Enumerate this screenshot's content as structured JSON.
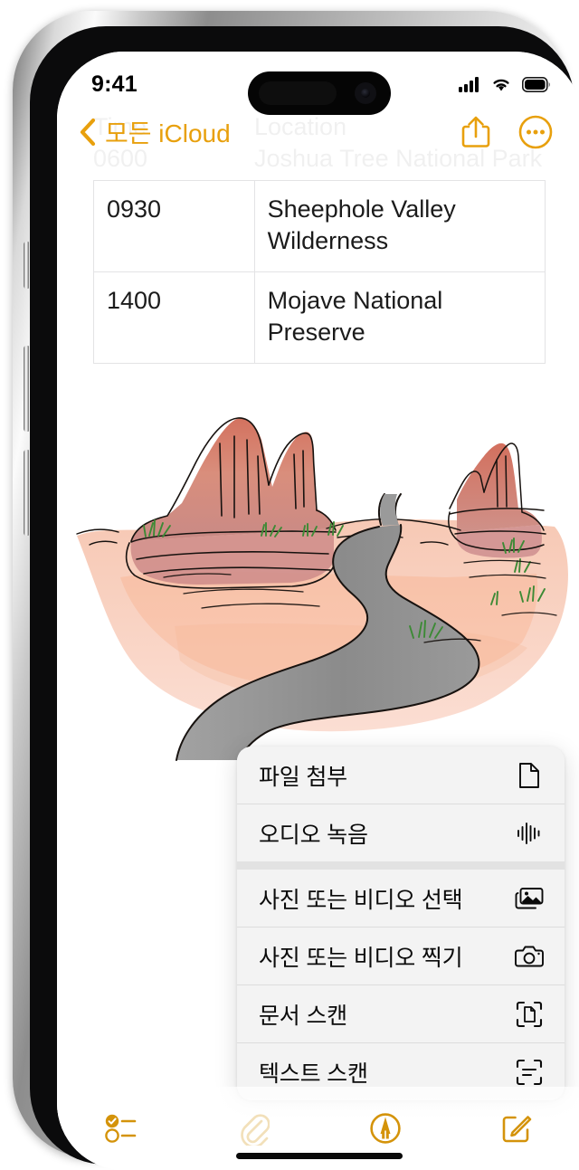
{
  "device": {
    "name": "iphone-15-pro",
    "frame_color": "#b8b8b8",
    "bezel_color": "#0b0b0c"
  },
  "status_bar": {
    "time": "9:41",
    "cellular_icon": "cellular-bars-icon",
    "wifi_icon": "wifi-icon",
    "battery_icon": "battery-full-icon",
    "battery_level": 100
  },
  "nav_bar": {
    "back_label": "모든 iCloud",
    "back_chevron_icon": "chevron-left-icon",
    "share_icon": "share-icon",
    "more_icon": "ellipsis-circle-icon",
    "accent_color": "#e8a00d"
  },
  "note": {
    "ghost_header": {
      "col1": "Time",
      "col2": "Location"
    },
    "ghost_row": {
      "col1": "0600",
      "col2": "Joshua Tree National Park"
    },
    "table": {
      "columns": [
        "Time",
        "Location"
      ],
      "rows": [
        {
          "time": "0930",
          "location": "Sheephole Valley Wilderness"
        },
        {
          "time": "1400",
          "location": "Mojave National Preserve"
        }
      ]
    },
    "illustration": {
      "name": "desert-landscape-sketch",
      "description": "Hand drawn watercolor sketch of desert mesas and a winding road",
      "colors": {
        "mesa_rock": "#d08878",
        "mesa_highlight": "#e8a58c",
        "sand": "#f7cdbb",
        "sand_light": "#fbe0d5",
        "road": "#8e8e8e",
        "grass": "#3f8f3a",
        "outline": "#17120f"
      }
    }
  },
  "attach_menu": {
    "background_color": "#f3f3f3",
    "groups": [
      {
        "items": [
          {
            "label": "파일 첨부",
            "icon": "document-icon"
          },
          {
            "label": "오디오 녹음",
            "icon": "audio-waveform-icon"
          }
        ]
      },
      {
        "items": [
          {
            "label": "사진 또는 비디오 선택",
            "icon": "photo-library-icon"
          },
          {
            "label": "사진 또는 비디오 찍기",
            "icon": "camera-icon"
          },
          {
            "label": "문서 스캔",
            "icon": "document-scan-icon"
          },
          {
            "label": "텍스트 스캔",
            "icon": "text-scan-icon"
          }
        ]
      }
    ]
  },
  "bottom_toolbar": {
    "items": [
      {
        "name": "checklist",
        "icon": "checklist-icon",
        "state": "enabled"
      },
      {
        "name": "attachment",
        "icon": "paperclip-icon",
        "state": "dimmed"
      },
      {
        "name": "markup",
        "icon": "markup-pen-circle-icon",
        "state": "active"
      },
      {
        "name": "compose",
        "icon": "compose-icon",
        "state": "enabled"
      }
    ],
    "accent_color": "#d4930a"
  }
}
